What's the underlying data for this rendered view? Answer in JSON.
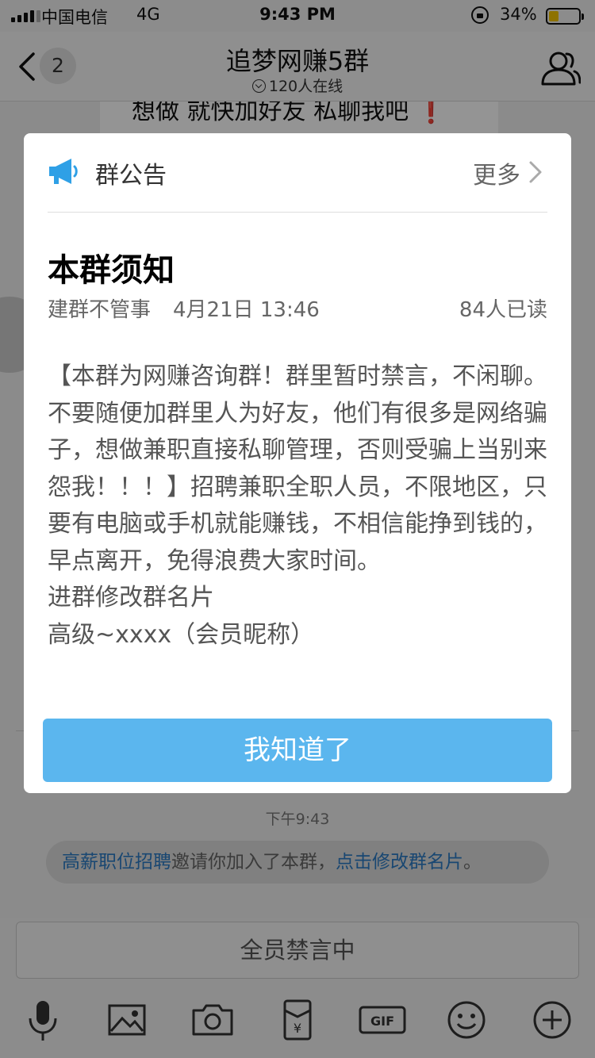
{
  "status_bar": {
    "carrier": "中国电信",
    "network": "4G",
    "time": "9:43 PM",
    "battery_percent": "34%",
    "battery_level": 0.34,
    "battery_color": "#f5c400"
  },
  "nav": {
    "unread_count": "2",
    "title": "追梦网赚5群",
    "online": "120人在线",
    "icons": [
      "back-icon",
      "group-members-icon"
    ]
  },
  "chat": {
    "partial_message": "想做 就快加好友 私聊我吧 ❗",
    "timestamp": "下午9:43",
    "system_notice": {
      "inviter": "高薪职位招聘",
      "middle": "邀请你加入了本群，",
      "action": "点击修改群名片",
      "end": "。"
    },
    "link_color": "#2b7bc4"
  },
  "input": {
    "mute_text": "全员禁言中",
    "toolbar_icons": [
      "microphone-icon",
      "image-icon",
      "camera-icon",
      "red-packet-icon",
      "gif-icon",
      "emoji-icon",
      "plus-icon"
    ]
  },
  "dialog": {
    "header": "群公告",
    "more": "更多",
    "title": "本群须知",
    "author": "建群不管事",
    "time": "4月21日 13:46",
    "read_count": "84人已读",
    "body_main": "【本群为网赚咨询群！群里暂时禁言，不闲聊。不要随便加群里人为好友，他们有很多是网络骗子，想做兼职直接私聊管理，否则受骗上当别来怨我！！！】招聘兼职全职人员，不限地区，只要有电脑或手机就能赚钱，不相信能挣到钱的，早点离开，免得浪费大家时间。",
    "body_line2": "进群修改群名片",
    "body_line3": "高级~xxxx（会员昵称）",
    "button": "我知道了",
    "button_color": "#5bb6ee",
    "accent_icon": "megaphone-icon"
  }
}
